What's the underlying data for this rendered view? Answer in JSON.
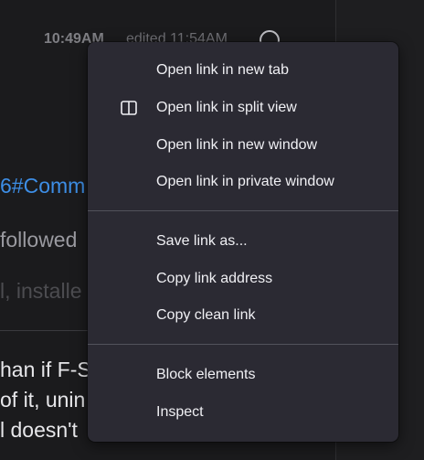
{
  "background": {
    "time": "10:49AM",
    "edited": "edited 11:54AM",
    "link_fragment": "6#Comm",
    "followed_fragment": "followed",
    "installed_fragment": "l, installe",
    "text_lines": [
      "han if F-Sc",
      "of it, unin",
      "l doesn't"
    ]
  },
  "context_menu": {
    "items": [
      {
        "label": "Open link in new tab",
        "icon": null
      },
      {
        "label": "Open link in split view",
        "icon": "split-view-icon"
      },
      {
        "label": "Open link in new window",
        "icon": null
      },
      {
        "label": "Open link in private window",
        "icon": null
      },
      {
        "label": "Save link as...",
        "icon": null
      },
      {
        "label": "Copy link address",
        "icon": null
      },
      {
        "label": "Copy clean link",
        "icon": null
      },
      {
        "label": "Block elements",
        "icon": null
      },
      {
        "label": "Inspect",
        "icon": null
      }
    ]
  },
  "colors": {
    "menu_background": "#2b2a33",
    "menu_text": "#f0f0f4",
    "separator": "#52525b",
    "page_background": "#1b1b1d",
    "link": "#3d8ee6"
  }
}
